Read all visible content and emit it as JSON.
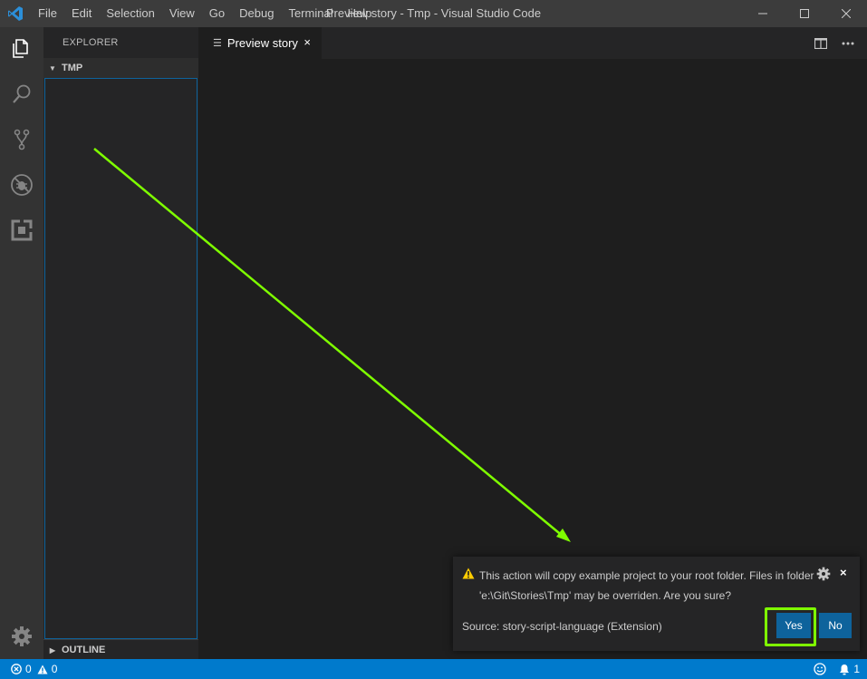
{
  "titlebar": {
    "menu": [
      "File",
      "Edit",
      "Selection",
      "View",
      "Go",
      "Debug",
      "Terminal",
      "Help"
    ],
    "title": "Preview story - Tmp - Visual Studio Code"
  },
  "activitybar": {
    "items": [
      "files-icon",
      "search-icon",
      "source-control-icon",
      "debug-icon",
      "extensions-icon",
      "settings-gear-icon"
    ]
  },
  "sidebar": {
    "title": "EXPLORER",
    "folder": "TMP",
    "outline": "OUTLINE"
  },
  "editor": {
    "tab_label": "Preview story",
    "tab_close": "×"
  },
  "notification": {
    "message": "This action will copy example project to your root folder. Files in folder 'e:\\Git\\Stories\\Tmp' may be overriden. Are you sure?",
    "source": "Source: story-script-language (Extension)",
    "yes_label": "Yes",
    "no_label": "No",
    "close": "×"
  },
  "statusbar": {
    "errors": "0",
    "warnings": "0",
    "notifications": "1"
  },
  "colors": {
    "accent": "#007acc",
    "button": "#0e639c",
    "highlight": "#7fff00",
    "warning": "#ffcc00"
  }
}
